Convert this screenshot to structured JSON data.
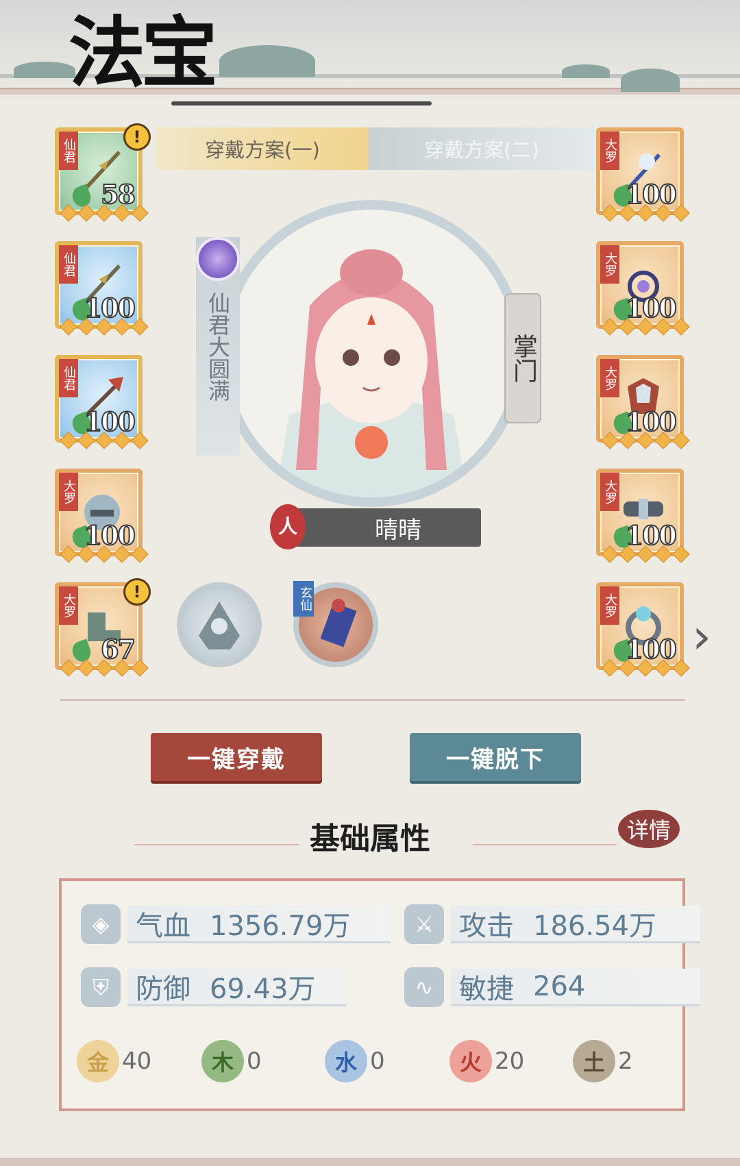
{
  "page": {
    "title": "法宝"
  },
  "tabs": [
    {
      "label": "穿戴方案(一)",
      "active": true
    },
    {
      "label": "穿戴方案(二)",
      "active": false
    }
  ],
  "left_slots": [
    {
      "tag": "仙君",
      "level": "58",
      "alert": true,
      "style": "green"
    },
    {
      "tag": "仙君",
      "level": "100",
      "alert": false,
      "style": "blue"
    },
    {
      "tag": "仙君",
      "level": "100",
      "alert": false,
      "style": "blue"
    },
    {
      "tag": "大罗",
      "level": "100",
      "alert": false,
      "style": "tan"
    },
    {
      "tag": "大罗",
      "level": "67",
      "alert": true,
      "style": "tan"
    }
  ],
  "right_slots": [
    {
      "tag": "大罗",
      "level": "100"
    },
    {
      "tag": "大罗",
      "level": "100"
    },
    {
      "tag": "大罗",
      "level": "100"
    },
    {
      "tag": "大罗",
      "level": "100"
    },
    {
      "tag": "大罗",
      "level": "100"
    }
  ],
  "character": {
    "realm": "仙君大圆满",
    "role": "掌门",
    "race": "人",
    "name": "晴晴"
  },
  "orbs": [
    {
      "tag": ""
    },
    {
      "tag": "玄仙"
    }
  ],
  "buttons": {
    "wear_all": "一键穿戴",
    "remove_all": "一键脱下"
  },
  "section": {
    "title": "基础属性",
    "detail": "详情"
  },
  "stats": [
    {
      "label": "气血",
      "value": "1356.79万",
      "icon": "blood-drop-icon"
    },
    {
      "label": "攻击",
      "value": "186.54万",
      "icon": "attack-icon"
    },
    {
      "label": "防御",
      "value": "69.43万",
      "icon": "shield-icon"
    },
    {
      "label": "敏捷",
      "value": "264",
      "icon": "agility-icon"
    }
  ],
  "elements": [
    {
      "name": "金",
      "value": "40",
      "color": "#e8c37a"
    },
    {
      "name": "木",
      "value": "0",
      "color": "#7fa86b"
    },
    {
      "name": "水",
      "value": "0",
      "color": "#8fb2d6"
    },
    {
      "name": "火",
      "value": "20",
      "color": "#e4857a"
    },
    {
      "name": "土",
      "value": "2",
      "color": "#9a8d78"
    }
  ]
}
